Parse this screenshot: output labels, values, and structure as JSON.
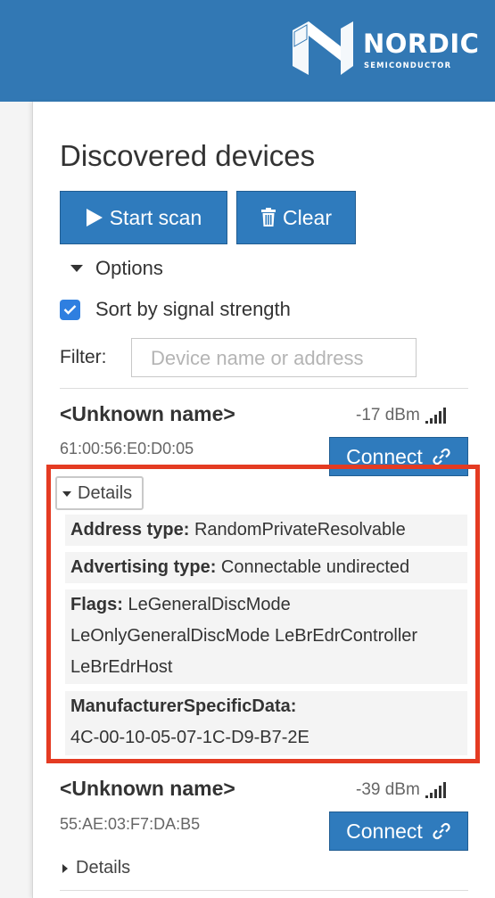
{
  "brand": {
    "name": "NORDIC",
    "tagline": "SEMICONDUCTOR",
    "header_color": "#3278b4"
  },
  "page": {
    "title": "Discovered devices"
  },
  "toolbar": {
    "start_scan_label": "Start scan",
    "start_scan_icon": "play-icon",
    "clear_label": "Clear",
    "clear_icon": "trash-icon"
  },
  "options": {
    "label": "Options",
    "expanded": true,
    "sort_by_signal": {
      "label": "Sort by signal strength",
      "checked": true
    },
    "filter": {
      "label": "Filter:",
      "placeholder": "Device name or address",
      "value": ""
    }
  },
  "devices": [
    {
      "name": "<Unknown name>",
      "address": "61:00:56:E0:D0:05",
      "rssi": "-17 dBm",
      "signal_bars": 5,
      "connect_label": "Connect",
      "details_label": "Details",
      "details_expanded": true,
      "details": {
        "address_type_label": "Address type:",
        "address_type_value": "RandomPrivateResolvable",
        "advertising_type_label": "Advertising type:",
        "advertising_type_value": "Connectable undirected",
        "flags_label": "Flags:",
        "flags_line1": "LeGeneralDiscMode",
        "flags_line2": "LeOnlyGeneralDiscMode LeBrEdrController",
        "flags_line3": "LeBrEdrHost",
        "manufacturer_label": "ManufacturerSpecificData:",
        "manufacturer_value": "4C-00-10-05-07-1C-D9-B7-2E"
      }
    },
    {
      "name": "<Unknown name>",
      "address": "55:AE:03:F7:DA:B5",
      "rssi": "-39 dBm",
      "signal_bars": 5,
      "connect_label": "Connect",
      "details_label": "Details",
      "details_expanded": false
    }
  ],
  "annotation": {
    "highlight_color": "#e43b22"
  }
}
